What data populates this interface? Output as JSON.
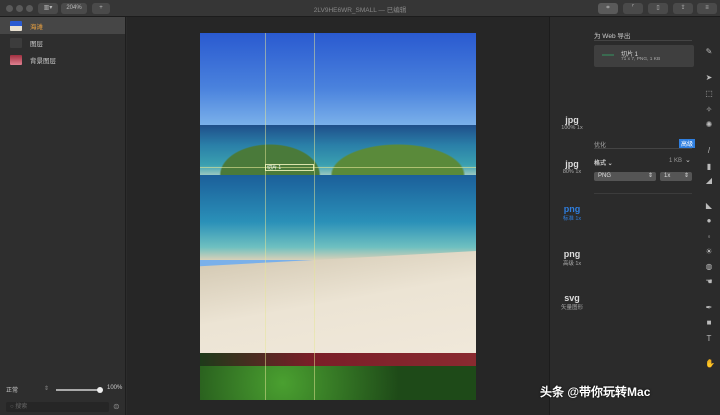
{
  "window": {
    "title": "2LV9HE6WR_SMALL — 已编辑",
    "zoom": "204%",
    "add_label": "+"
  },
  "layers": [
    {
      "name": "海滩",
      "selected": true
    },
    {
      "name": "图层"
    },
    {
      "name": "背景图层"
    }
  ],
  "blend": {
    "mode": "正常",
    "opacity": "100%",
    "opacity_value": 1.0
  },
  "search": {
    "placeholder": "搜索"
  },
  "canvas": {
    "slice_label": "切片 1"
  },
  "export": {
    "title": "为 Web 导出",
    "slice_name": "切片 1",
    "slice_info": "71 x 7, PNG, 1 KB",
    "presets": [
      {
        "format": "jpg",
        "sub": "100% 1x"
      },
      {
        "format": "jpg",
        "sub": "80% 1x"
      },
      {
        "format": "png",
        "sub": "标准 1x",
        "selected": true
      },
      {
        "format": "png",
        "sub": "高级 1x"
      },
      {
        "format": "svg",
        "sub": "矢量图形"
      }
    ],
    "optimize_label": "优化",
    "advanced_label": "高级",
    "format_label": "格式 ⌄",
    "size": "1 KB",
    "format_value": "PNG",
    "scale_value": "1x"
  },
  "accent": "#2f7fe0",
  "watermark": "头条 @带你玩转Mac"
}
